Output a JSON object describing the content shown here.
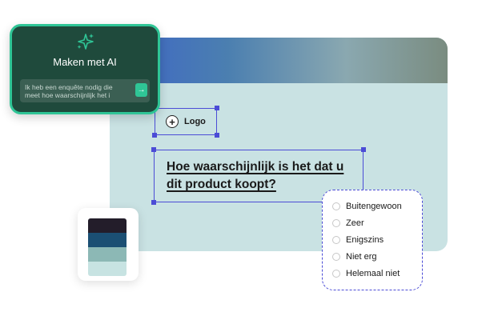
{
  "ai_card": {
    "title": "Maken met AI",
    "input_text": "Ik heb een enquête nodig die meet hoe waarschijnlijk het i",
    "send_icon": "arrow-right-icon",
    "sparkle_icon": "sparkle-icon",
    "accent_color": "#2fc596",
    "bg_color": "#1f4a3c"
  },
  "canvas": {
    "logo_label": "Logo",
    "question": "Hoe waarschijnlijk is het dat u dit product koopt?",
    "bg_color": "#c9e2e3"
  },
  "palette": {
    "colors": [
      "#231d2a",
      "#1b4f73",
      "#8cb8b5",
      "#c7e3e2"
    ]
  },
  "options": {
    "items": [
      "Buitengewoon",
      "Zeer",
      "Enigszins",
      "Niet erg",
      "Helemaal niet"
    ]
  },
  "selection_color": "#4b4cd6"
}
